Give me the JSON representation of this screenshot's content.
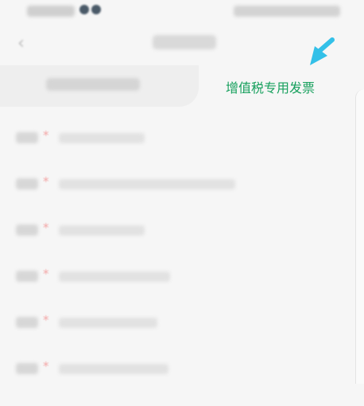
{
  "tabs": {
    "active_label": "增值税专用发票"
  },
  "icons": {
    "back": "chevron-left-icon",
    "pointer": "arrow-pointer-icon"
  },
  "colors": {
    "active_tab_text": "#17a05d",
    "arrow": "#33c0e8",
    "required_star": "#f3a6a6"
  },
  "form": {
    "rows": [
      {
        "star": "*"
      },
      {
        "star": "*"
      },
      {
        "star": "*"
      },
      {
        "star": "*"
      },
      {
        "star": "*"
      },
      {
        "star": "*"
      }
    ]
  }
}
